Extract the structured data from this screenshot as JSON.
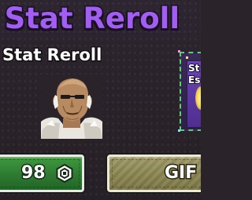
{
  "banner": {
    "title": "l Stat Reroll"
  },
  "product": {
    "name": "Stat Reroll",
    "portrait_icon": "bald-fighter-portrait"
  },
  "side_card": {
    "text_line1": "St",
    "text_line2": "Es"
  },
  "purchase": {
    "price": "98",
    "currency_icon": "robux-icon"
  },
  "gift": {
    "label": "GIF"
  },
  "colors": {
    "banner_purple": "#a25ef2",
    "price_green": "#2f7c33",
    "gift_khaki": "#8d8753",
    "side_card_border": "#5ad06b"
  }
}
